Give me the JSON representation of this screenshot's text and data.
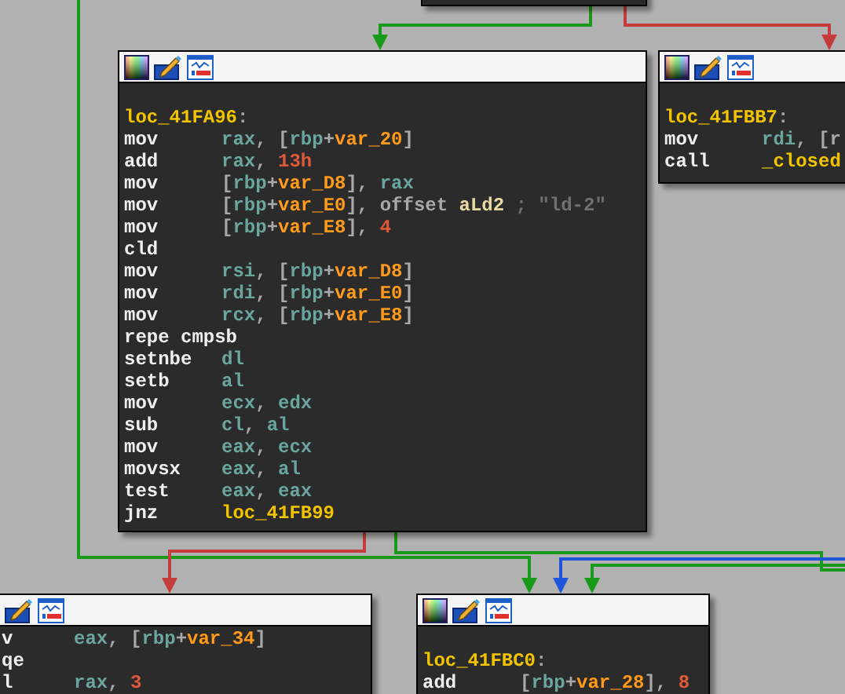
{
  "nodes": [
    {
      "kind": "stub"
    },
    {
      "kind": "block",
      "icons": [
        {
          "kind": "palette"
        },
        {
          "kind": "edit"
        },
        {
          "kind": "graph"
        }
      ],
      "lines": [
        {
          "kind": "blank"
        },
        {
          "kind": "label",
          "args": [
            {
              "kind": "label",
              "text": "loc_41FA96"
            },
            {
              "kind": "p",
              "text": ":"
            }
          ]
        },
        {
          "kind": "insn",
          "op": "mov",
          "args": [
            {
              "kind": "reg",
              "text": "rax"
            },
            {
              "kind": "p",
              "text": ", ["
            },
            {
              "kind": "reg",
              "text": "rbp"
            },
            {
              "kind": "p",
              "text": "+"
            },
            {
              "kind": "var",
              "text": "var_20"
            },
            {
              "kind": "p",
              "text": "]"
            }
          ]
        },
        {
          "kind": "insn",
          "op": "add",
          "args": [
            {
              "kind": "reg",
              "text": "rax"
            },
            {
              "kind": "p",
              "text": ", "
            },
            {
              "kind": "num",
              "text": "13h"
            }
          ]
        },
        {
          "kind": "insn",
          "op": "mov",
          "args": [
            {
              "kind": "p",
              "text": "["
            },
            {
              "kind": "reg",
              "text": "rbp"
            },
            {
              "kind": "p",
              "text": "+"
            },
            {
              "kind": "var",
              "text": "var_D8"
            },
            {
              "kind": "p",
              "text": "], "
            },
            {
              "kind": "reg",
              "text": "rax"
            }
          ]
        },
        {
          "kind": "insn",
          "op": "mov",
          "args": [
            {
              "kind": "p",
              "text": "["
            },
            {
              "kind": "reg",
              "text": "rbp"
            },
            {
              "kind": "p",
              "text": "+"
            },
            {
              "kind": "var",
              "text": "var_E0"
            },
            {
              "kind": "p",
              "text": "], "
            },
            {
              "kind": "kw",
              "text": "offset "
            },
            {
              "kind": "name",
              "text": "aLd2"
            },
            {
              "kind": "cmt",
              "text": " ; \"ld-2\""
            }
          ]
        },
        {
          "kind": "insn",
          "op": "mov",
          "args": [
            {
              "kind": "p",
              "text": "["
            },
            {
              "kind": "reg",
              "text": "rbp"
            },
            {
              "kind": "p",
              "text": "+"
            },
            {
              "kind": "var",
              "text": "var_E8"
            },
            {
              "kind": "p",
              "text": "], "
            },
            {
              "kind": "num",
              "text": "4"
            }
          ]
        },
        {
          "kind": "insn",
          "op": "cld"
        },
        {
          "kind": "insn",
          "op": "mov",
          "args": [
            {
              "kind": "reg",
              "text": "rsi"
            },
            {
              "kind": "p",
              "text": ", ["
            },
            {
              "kind": "reg",
              "text": "rbp"
            },
            {
              "kind": "p",
              "text": "+"
            },
            {
              "kind": "var",
              "text": "var_D8"
            },
            {
              "kind": "p",
              "text": "]"
            }
          ]
        },
        {
          "kind": "insn",
          "op": "mov",
          "args": [
            {
              "kind": "reg",
              "text": "rdi"
            },
            {
              "kind": "p",
              "text": ", ["
            },
            {
              "kind": "reg",
              "text": "rbp"
            },
            {
              "kind": "p",
              "text": "+"
            },
            {
              "kind": "var",
              "text": "var_E0"
            },
            {
              "kind": "p",
              "text": "]"
            }
          ]
        },
        {
          "kind": "insn",
          "op": "mov",
          "args": [
            {
              "kind": "reg",
              "text": "rcx"
            },
            {
              "kind": "p",
              "text": ", ["
            },
            {
              "kind": "reg",
              "text": "rbp"
            },
            {
              "kind": "p",
              "text": "+"
            },
            {
              "kind": "var",
              "text": "var_E8"
            },
            {
              "kind": "p",
              "text": "]"
            }
          ]
        },
        {
          "kind": "insn",
          "op": "repe cmpsb"
        },
        {
          "kind": "insn",
          "op": "setnbe",
          "args": [
            {
              "kind": "reg",
              "text": "dl"
            }
          ]
        },
        {
          "kind": "insn",
          "op": "setb",
          "args": [
            {
              "kind": "reg",
              "text": "al"
            }
          ]
        },
        {
          "kind": "insn",
          "op": "mov",
          "args": [
            {
              "kind": "reg",
              "text": "ecx"
            },
            {
              "kind": "p",
              "text": ", "
            },
            {
              "kind": "reg",
              "text": "edx"
            }
          ]
        },
        {
          "kind": "insn",
          "op": "sub",
          "args": [
            {
              "kind": "reg",
              "text": "cl"
            },
            {
              "kind": "p",
              "text": ", "
            },
            {
              "kind": "reg",
              "text": "al"
            }
          ]
        },
        {
          "kind": "insn",
          "op": "mov",
          "args": [
            {
              "kind": "reg",
              "text": "eax"
            },
            {
              "kind": "p",
              "text": ", "
            },
            {
              "kind": "reg",
              "text": "ecx"
            }
          ]
        },
        {
          "kind": "insn",
          "op": "movsx",
          "args": [
            {
              "kind": "reg",
              "text": "eax"
            },
            {
              "kind": "p",
              "text": ", "
            },
            {
              "kind": "reg",
              "text": "al"
            }
          ]
        },
        {
          "kind": "insn",
          "op": "test",
          "args": [
            {
              "kind": "reg",
              "text": "eax"
            },
            {
              "kind": "p",
              "text": ", "
            },
            {
              "kind": "reg",
              "text": "eax"
            }
          ]
        },
        {
          "kind": "insn",
          "op": "jnz",
          "args": [
            {
              "kind": "label",
              "text": "loc_41FB99"
            }
          ]
        }
      ]
    },
    {
      "kind": "block",
      "icons": [
        {
          "kind": "palette"
        },
        {
          "kind": "edit"
        },
        {
          "kind": "graph"
        }
      ],
      "lines": [
        {
          "kind": "blank"
        },
        {
          "kind": "label",
          "args": [
            {
              "kind": "label",
              "text": "loc_41FBB7"
            },
            {
              "kind": "p",
              "text": ":"
            }
          ]
        },
        {
          "kind": "insn",
          "op": "mov",
          "args": [
            {
              "kind": "reg",
              "text": "rdi"
            },
            {
              "kind": "p",
              "text": ", [r"
            }
          ]
        },
        {
          "kind": "insn",
          "op": "call",
          "args": [
            {
              "kind": "label",
              "text": "_closed"
            }
          ]
        }
      ]
    },
    {
      "kind": "block",
      "icons": [
        {
          "kind": "edit"
        },
        {
          "kind": "graph"
        }
      ],
      "lines": [
        {
          "kind": "insn",
          "op": "v",
          "args": [
            {
              "kind": "reg",
              "text": "eax"
            },
            {
              "kind": "p",
              "text": ", ["
            },
            {
              "kind": "reg",
              "text": "rbp"
            },
            {
              "kind": "p",
              "text": "+"
            },
            {
              "kind": "var",
              "text": "var_34"
            },
            {
              "kind": "p",
              "text": "]"
            }
          ]
        },
        {
          "kind": "insn",
          "op": "qe"
        },
        {
          "kind": "insn",
          "op": "l",
          "args": [
            {
              "kind": "reg",
              "text": "rax"
            },
            {
              "kind": "p",
              "text": ", "
            },
            {
              "kind": "num",
              "text": "3"
            }
          ]
        }
      ]
    },
    {
      "kind": "block",
      "icons": [
        {
          "kind": "palette"
        },
        {
          "kind": "edit"
        },
        {
          "kind": "graph"
        }
      ],
      "lines": [
        {
          "kind": "blank"
        },
        {
          "kind": "label",
          "args": [
            {
              "kind": "label",
              "text": "loc_41FBC0"
            },
            {
              "kind": "p",
              "text": ":"
            }
          ]
        },
        {
          "kind": "insn",
          "op": "add",
          "args": [
            {
              "kind": "p",
              "text": "["
            },
            {
              "kind": "reg",
              "text": "rbp"
            },
            {
              "kind": "p",
              "text": "+"
            },
            {
              "kind": "var",
              "text": "var_28"
            },
            {
              "kind": "p",
              "text": "], "
            },
            {
              "kind": "num",
              "text": "8"
            }
          ]
        }
      ]
    }
  ],
  "edges": [
    {
      "color": "#1a9a1a"
    },
    {
      "color": "#c43c3c"
    },
    {
      "color": "#1a9a1a"
    },
    {
      "color": "#c43c3c"
    },
    {
      "color": "#1a9a1a"
    },
    {
      "color": "#1f55dd"
    },
    {
      "color": "#1a9a1a"
    }
  ]
}
